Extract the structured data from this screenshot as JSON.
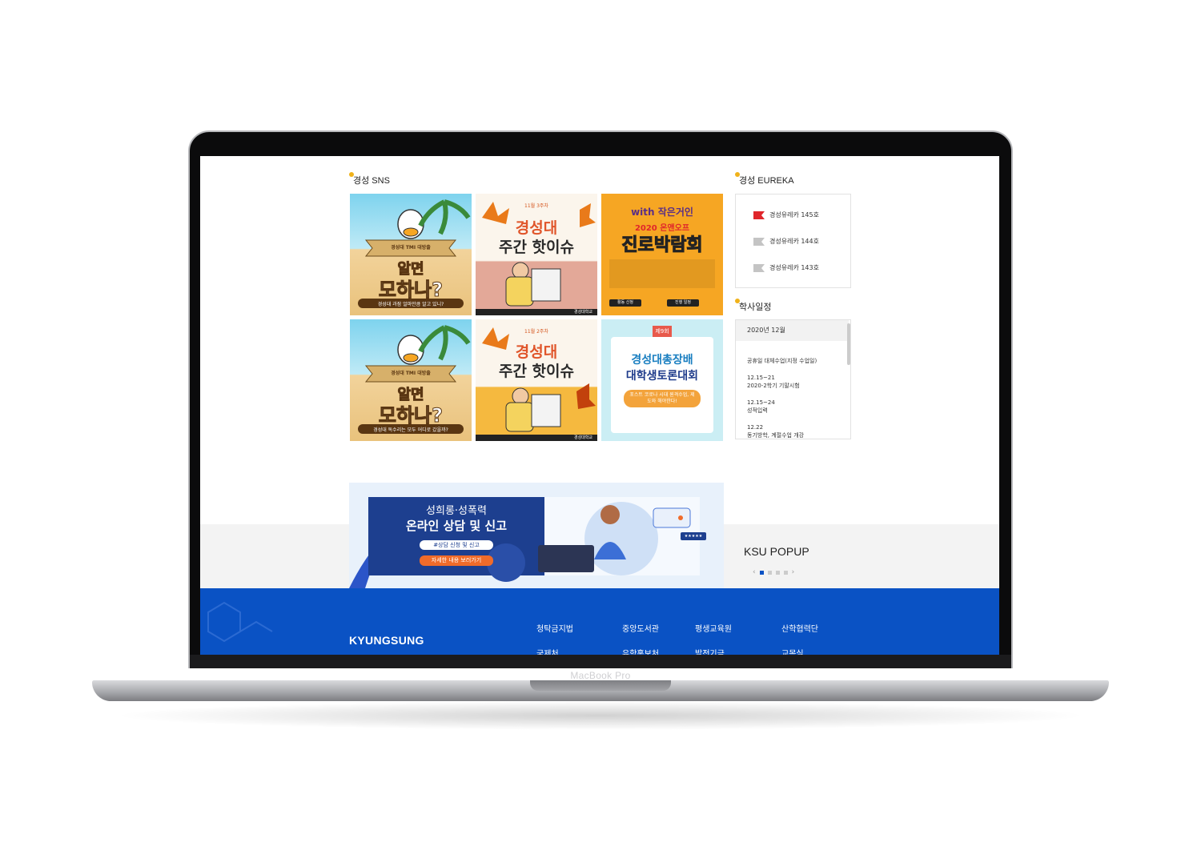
{
  "device": {
    "label": "MacBook Pro"
  },
  "sns": {
    "title": "경성 SNS",
    "tiles": [
      {
        "tag": "경성대 TMI 대방출",
        "big1": "알면",
        "big2": "모하나?",
        "bar": "경성대 과잠 얼마만큼 알고 있니?"
      },
      {
        "tag": "11월 3주차",
        "big1": "경성대",
        "big2": "주간 핫이슈",
        "bar": "경성대학교"
      },
      {
        "tag": "with 작은거인",
        "small": "2020 온앤오프",
        "big1": "진로박람회",
        "bar1": "활동 신청",
        "bar2": "진행 일정"
      },
      {
        "tag": "경성대 TMI 대방출",
        "big1": "알면",
        "big2": "모하나?",
        "bar": "경성대 독수리는 모두 어디로 갔을까?"
      },
      {
        "tag": "11월 2주차",
        "big1": "경성대",
        "big2": "주간 핫이슈",
        "bar": "경성대학교"
      },
      {
        "tag": "제9회",
        "big1": "경성대총장배",
        "big2": "대학생토론대회",
        "bar": "포스트 코로나 시대 원격수업, 제도와 해야한다!"
      }
    ]
  },
  "eureka": {
    "title": "경성 EUREKA",
    "items": [
      {
        "label": "경성유레카 145호",
        "color": "#e0262b"
      },
      {
        "label": "경성유레카 144호",
        "color": "#c4c4c4"
      },
      {
        "label": "경성유레카 143호",
        "color": "#c4c4c4"
      }
    ]
  },
  "schedule": {
    "title": "학사일정",
    "month": "2020년 12월",
    "items": [
      {
        "date": "",
        "text": "공휴일 대체수업(지정 수업일)"
      },
      {
        "date": "12.15~21",
        "text": "2020-2학기 기말시험"
      },
      {
        "date": "12.15~24",
        "text": "성적입력"
      },
      {
        "date": "12.22",
        "text": "동기방학, 계절수업 개강"
      }
    ]
  },
  "banner": {
    "line1": "성희롱·성폭력",
    "line2": "온라인 상담 및 신고",
    "pill1": "#상담 신청 및 신고",
    "pill2": "자세한 내용 보러가기",
    "stars": "★★★★★"
  },
  "popup": {
    "title": "KSU POPUP",
    "prev": "‹",
    "next": "›"
  },
  "footer": {
    "logo": "KYUNGSUNG",
    "links": [
      {
        "label": "청탁금지법",
        "row": 0,
        "col": 0
      },
      {
        "label": "중앙도서관",
        "row": 0,
        "col": 1
      },
      {
        "label": "평생교육원",
        "row": 0,
        "col": 2
      },
      {
        "label": "산학협력단",
        "row": 0,
        "col": 3
      },
      {
        "label": "국제처",
        "row": 1,
        "col": 0
      },
      {
        "label": "유학홍보처",
        "row": 1,
        "col": 1
      },
      {
        "label": "발전기금",
        "row": 1,
        "col": 2
      },
      {
        "label": "교목실",
        "row": 1,
        "col": 3
      }
    ]
  }
}
